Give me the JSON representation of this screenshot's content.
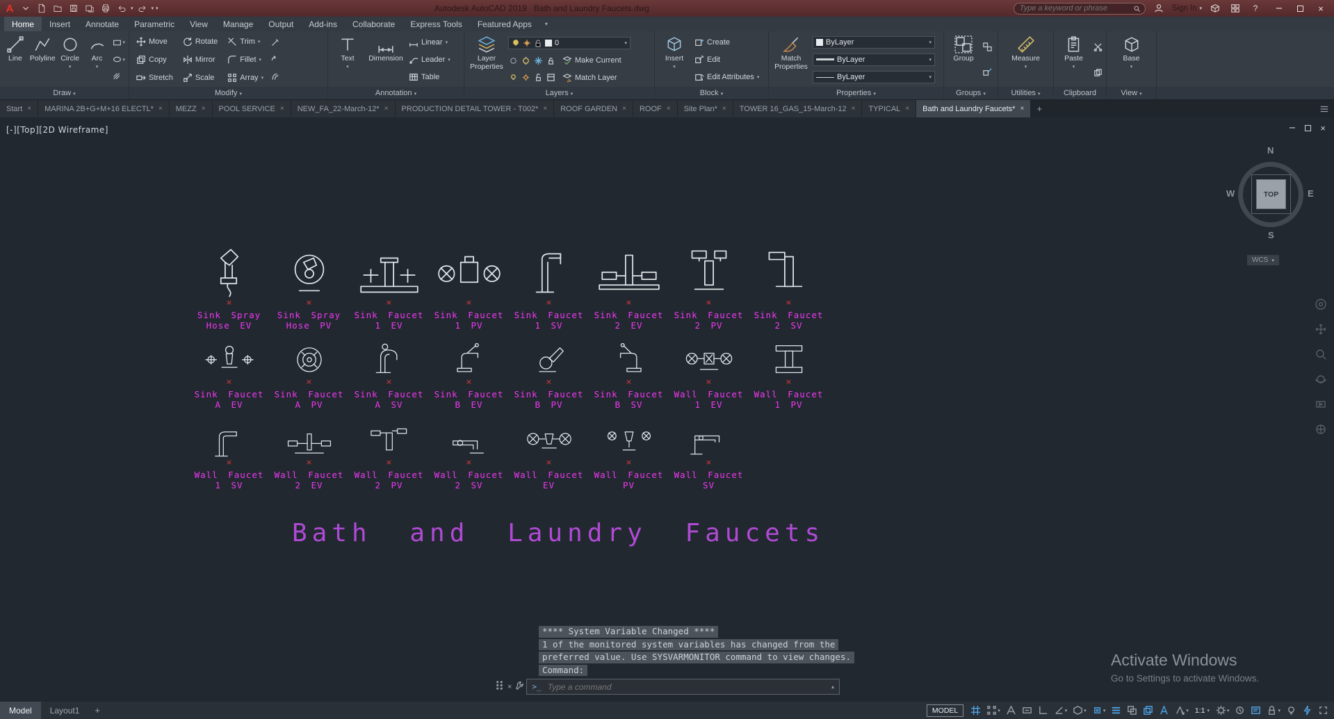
{
  "title_bar": {
    "app_title": "Autodesk AutoCAD 2019",
    "doc_title": "Bath and Laundry Faucets.dwg",
    "search_placeholder": "Type a keyword or phrase",
    "sign_in": "Sign In"
  },
  "icons": {
    "caret_down": "▾",
    "close": "×",
    "minimize": "−",
    "plus": "+",
    "up": "▴",
    "help": "?"
  },
  "ribbon": {
    "tabs": [
      {
        "label": "Home",
        "active": true
      },
      {
        "label": "Insert"
      },
      {
        "label": "Annotate"
      },
      {
        "label": "Parametric"
      },
      {
        "label": "View"
      },
      {
        "label": "Manage"
      },
      {
        "label": "Output"
      },
      {
        "label": "Add-ins"
      },
      {
        "label": "Collaborate"
      },
      {
        "label": "Express Tools"
      },
      {
        "label": "Featured Apps"
      }
    ],
    "draw": {
      "label": "Draw",
      "line": "Line",
      "polyline": "Polyline",
      "circle": "Circle",
      "arc": "Arc"
    },
    "modify": {
      "label": "Modify",
      "move": "Move",
      "rotate": "Rotate",
      "trim": "Trim",
      "copy": "Copy",
      "mirror": "Mirror",
      "fillet": "Fillet",
      "stretch": "Stretch",
      "scale": "Scale",
      "array": "Array"
    },
    "annotation": {
      "label": "Annotation",
      "text": "Text",
      "dimension": "Dimension",
      "linear": "Linear",
      "leader": "Leader",
      "table": "Table"
    },
    "layers": {
      "label": "Layers",
      "layer_properties": "Layer Properties",
      "make_current": "Make Current",
      "match_layer": "Match Layer",
      "current_layer": "0"
    },
    "block": {
      "label": "Block",
      "insert": "Insert",
      "create": "Create",
      "edit": "Edit",
      "edit_attributes": "Edit Attributes"
    },
    "properties": {
      "label": "Properties",
      "match_properties": "Match Properties",
      "color": "ByLayer",
      "lineweight": "ByLayer",
      "linetype": "ByLayer"
    },
    "groups": {
      "label": "Groups",
      "group": "Group"
    },
    "utilities": {
      "label": "Utilities",
      "measure": "Measure"
    },
    "clipboard": {
      "label": "Clipboard",
      "paste": "Paste"
    },
    "view": {
      "label": "View",
      "base": "Base"
    }
  },
  "file_tabs": [
    {
      "label": "Start"
    },
    {
      "label": "MARINA 2B+G+M+16 ELECTL*"
    },
    {
      "label": "MEZZ"
    },
    {
      "label": "POOL SERVICE"
    },
    {
      "label": "NEW_FA_22-March-12*"
    },
    {
      "label": "PRODUCTION DETAIL TOWER - T002*"
    },
    {
      "label": "ROOF GARDEN"
    },
    {
      "label": "ROOF"
    },
    {
      "label": "Site Plan*"
    },
    {
      "label": "TOWER 16_GAS_15-March-12"
    },
    {
      "label": "TYPICAL"
    },
    {
      "label": "Bath and Laundry Faucets*",
      "active": true
    }
  ],
  "viewport": {
    "label": "[-][Top][2D Wireframe]"
  },
  "viewcube": {
    "n": "N",
    "s": "S",
    "e": "E",
    "w": "W",
    "face": "TOP",
    "wcs": "WCS"
  },
  "symbols": {
    "rows": [
      [
        {
          "glyph": "spray-ev",
          "lines": [
            "Sink Spray",
            "Hose EV"
          ]
        },
        {
          "glyph": "spray-pv",
          "lines": [
            "Sink Spray",
            "Hose PV"
          ]
        },
        {
          "glyph": "f1-ev",
          "lines": [
            "Sink Faucet",
            "1 EV"
          ]
        },
        {
          "glyph": "f1-pv",
          "lines": [
            "Sink Faucet",
            "1 PV"
          ]
        },
        {
          "glyph": "f1-sv",
          "lines": [
            "Sink Faucet",
            "1 SV"
          ]
        },
        {
          "glyph": "f2-ev",
          "lines": [
            "Sink Faucet",
            "2 EV"
          ]
        },
        {
          "glyph": "f2-pv",
          "lines": [
            "Sink Faucet",
            "2 PV"
          ]
        },
        {
          "glyph": "f2-sv",
          "lines": [
            "Sink Faucet",
            "2 SV"
          ]
        }
      ],
      [
        {
          "glyph": "fa-ev",
          "lines": [
            "Sink Faucet",
            "A EV"
          ]
        },
        {
          "glyph": "fa-pv",
          "lines": [
            "Sink Faucet",
            "A PV"
          ]
        },
        {
          "glyph": "fa-sv",
          "lines": [
            "Sink Faucet",
            "A SV"
          ]
        },
        {
          "glyph": "fb-ev",
          "lines": [
            "Sink Faucet",
            "B EV"
          ]
        },
        {
          "glyph": "fb-pv",
          "lines": [
            "Sink Faucet",
            "B PV"
          ]
        },
        {
          "glyph": "fb-sv",
          "lines": [
            "Sink Faucet",
            "B SV"
          ]
        },
        {
          "glyph": "w1-ev",
          "lines": [
            "Wall Faucet",
            "1 EV"
          ]
        },
        {
          "glyph": "w1-pv",
          "lines": [
            "Wall Faucet",
            "1 PV"
          ]
        }
      ],
      [
        {
          "glyph": "w1-sv",
          "lines": [
            "Wall Faucet",
            "1 SV"
          ]
        },
        {
          "glyph": "w2-ev",
          "lines": [
            "Wall Faucet",
            "2 EV"
          ]
        },
        {
          "glyph": "w2-pv",
          "lines": [
            "Wall Faucet",
            "2 PV"
          ]
        },
        {
          "glyph": "w2-sv",
          "lines": [
            "Wall Faucet",
            "2 SV"
          ]
        },
        {
          "glyph": "w-ev",
          "lines": [
            "Wall Faucet",
            "EV"
          ]
        },
        {
          "glyph": "w-pv",
          "lines": [
            "Wall Faucet",
            "PV"
          ]
        },
        {
          "glyph": "w-sv",
          "lines": [
            "Wall Faucet",
            "SV"
          ]
        }
      ]
    ]
  },
  "drawing_title": "Bath and Laundry Faucets",
  "command_history": [
    "**** System Variable Changed ****",
    "1 of the monitored system variables has changed from the",
    "preferred value. Use SYSVARMONITOR command to view changes.",
    "Command:"
  ],
  "command_input": {
    "placeholder": "Type a command"
  },
  "watermark": {
    "line1": "Activate Windows",
    "line2": "Go to Settings to activate Windows."
  },
  "status_bar": {
    "model_tab": "Model",
    "layout_tab": "Layout1",
    "model_button": "MODEL",
    "annotation_scale": "1:1"
  }
}
